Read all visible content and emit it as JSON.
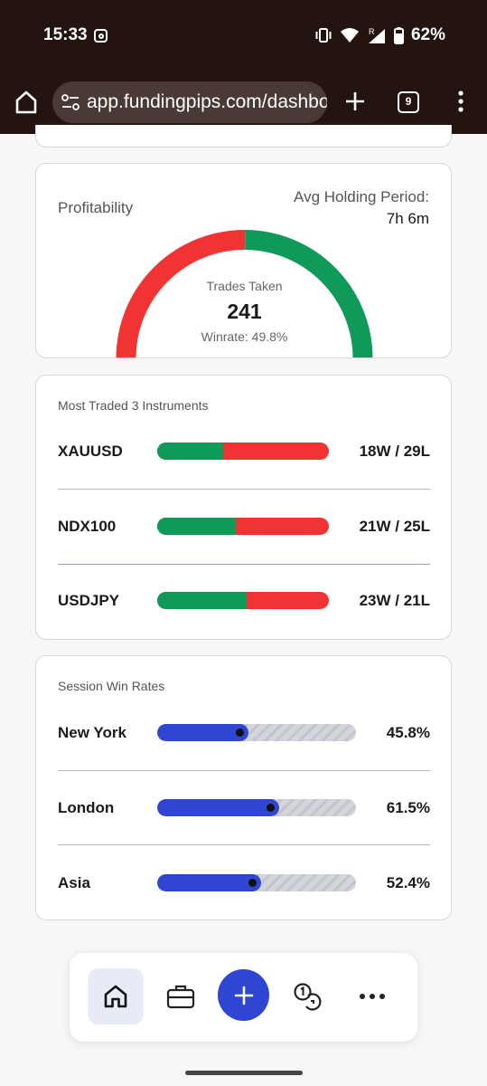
{
  "status_bar": {
    "time": "15:33",
    "battery": "62%"
  },
  "browser": {
    "url": "app.fundingpips.com/dashboard",
    "tab_count": "9"
  },
  "profitability": {
    "label": "Profitability",
    "avg_holding_label": "Avg Holding Period:",
    "avg_holding_value": "7h 6m",
    "trades_taken_label": "Trades Taken",
    "trades_taken": "241",
    "winrate": "Winrate: 49.8%",
    "winrate_fraction": 0.498,
    "colors": {
      "loss": "#f13333",
      "win": "#0f9a5a"
    }
  },
  "instruments": {
    "title": "Most Traded 3 Instruments",
    "items": [
      {
        "name": "XAUUSD",
        "record": "18W / 29L",
        "wins": 18,
        "losses": 29
      },
      {
        "name": "NDX100",
        "record": "21W / 25L",
        "wins": 21,
        "losses": 25
      },
      {
        "name": "USDJPY",
        "record": "23W / 21L",
        "wins": 23,
        "losses": 21
      }
    ]
  },
  "sessions": {
    "title": "Session Win Rates",
    "items": [
      {
        "name": "New York",
        "rate": "45.8%",
        "value": 0.458
      },
      {
        "name": "London",
        "rate": "61.5%",
        "value": 0.615
      },
      {
        "name": "Asia",
        "rate": "52.4%",
        "value": 0.524
      }
    ],
    "color": "#2f45d3"
  },
  "bottom_nav": {
    "icons": [
      "home-icon",
      "briefcase-icon",
      "plus-icon",
      "coins-icon",
      "more-horizontal-icon"
    ]
  }
}
